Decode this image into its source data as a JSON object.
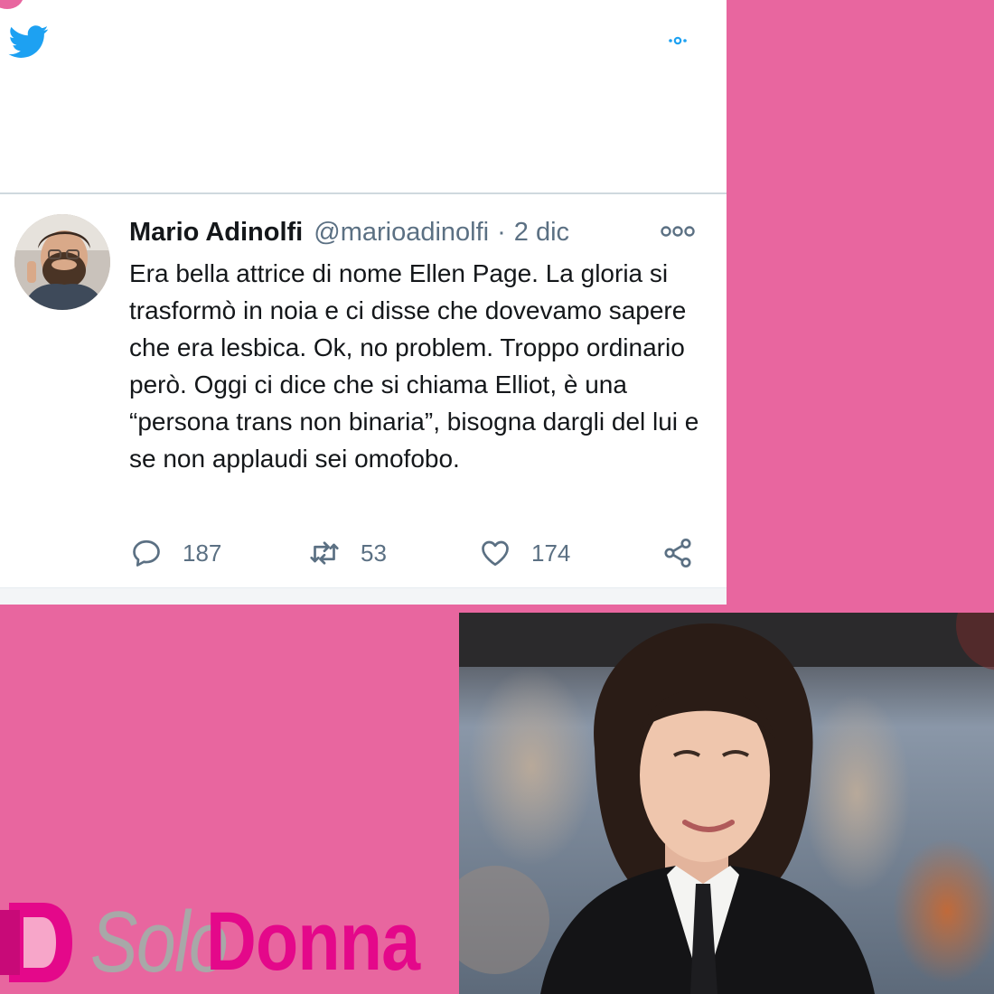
{
  "colors": {
    "background": "#e8669f",
    "twitter_blue": "#1da1f2",
    "secondary_text": "#5b7083",
    "brand_pink": "#e4088a",
    "brand_grey": "#a8a8a8"
  },
  "tweet": {
    "author_name": "Mario Adinolfi",
    "handle": "@marioadinolfi",
    "separator": "·",
    "date": "2 dic",
    "text": "Era bella attrice di nome Ellen Page. La gloria si trasformò in noia e ci disse che dovevamo sapere che era lesbica. Ok, no problem. Troppo ordinario però. Oggi ci dice che si chiama Elliot, è una “persona trans non binaria”, bisogna dargli del lui e se non applaudi sei omofobo.",
    "replies": "187",
    "retweets": "53",
    "likes": "174"
  },
  "icons": {
    "header": [
      "twitter-bird-icon",
      "more-dots-icon"
    ],
    "tweet": [
      "more-options-icon",
      "reply-icon",
      "retweet-icon",
      "like-heart-icon",
      "share-icon"
    ]
  },
  "logo": {
    "part1": "Solo",
    "part2": "Donna"
  }
}
